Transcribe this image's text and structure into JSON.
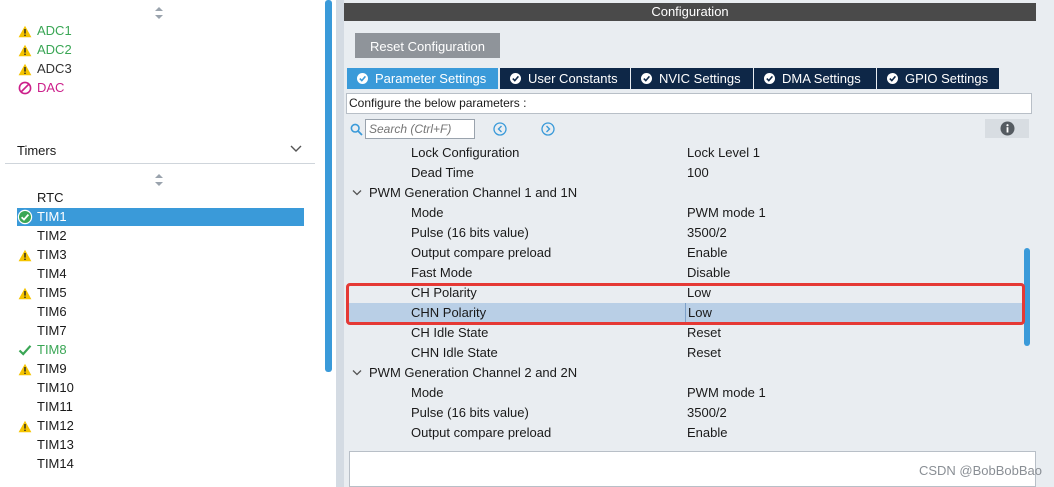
{
  "left": {
    "analog_items": [
      {
        "label": "ADC1",
        "icon": "warning-icon",
        "color": "#3aa655"
      },
      {
        "label": "ADC2",
        "icon": "warning-icon",
        "color": "#3aa655"
      },
      {
        "label": "ADC3",
        "icon": "warning-icon",
        "color": "#333333"
      },
      {
        "label": "DAC",
        "icon": "disabled-icon",
        "color": "#cc1f8a"
      }
    ],
    "section_title": "Timers",
    "timer_items": [
      {
        "label": "RTC",
        "icon": "none"
      },
      {
        "label": "TIM1",
        "icon": "check-circle-icon",
        "selected": true
      },
      {
        "label": "TIM2",
        "icon": "none"
      },
      {
        "label": "TIM3",
        "icon": "warning-icon"
      },
      {
        "label": "TIM4",
        "icon": "none"
      },
      {
        "label": "TIM5",
        "icon": "warning-icon"
      },
      {
        "label": "TIM6",
        "icon": "none"
      },
      {
        "label": "TIM7",
        "icon": "none"
      },
      {
        "label": "TIM8",
        "icon": "check-icon",
        "color": "#3aa655"
      },
      {
        "label": "TIM9",
        "icon": "warning-icon"
      },
      {
        "label": "TIM10",
        "icon": "none"
      },
      {
        "label": "TIM11",
        "icon": "none"
      },
      {
        "label": "TIM12",
        "icon": "warning-icon"
      },
      {
        "label": "TIM13",
        "icon": "none"
      },
      {
        "label": "TIM14",
        "icon": "none"
      }
    ]
  },
  "config": {
    "title": "Configuration",
    "reset_label": "Reset Configuration",
    "tabs": [
      {
        "label": "Parameter Settings",
        "active": true
      },
      {
        "label": "User Constants"
      },
      {
        "label": "NVIC Settings"
      },
      {
        "label": "DMA Settings"
      },
      {
        "label": "GPIO Settings"
      }
    ],
    "configure_text": "Configure the below parameters :",
    "search_placeholder": "Search (Ctrl+F)",
    "params": [
      {
        "name": "Lock Configuration",
        "value": "Lock Level 1"
      },
      {
        "name": "Dead Time",
        "value": "100"
      },
      {
        "name": "PWM Generation Channel 1 and 1N",
        "group": true
      },
      {
        "name": "Mode",
        "value": "PWM mode 1"
      },
      {
        "name": "Pulse (16 bits value)",
        "value": "3500/2"
      },
      {
        "name": "Output compare preload",
        "value": "Enable"
      },
      {
        "name": "Fast Mode",
        "value": "Disable"
      },
      {
        "name": "CH Polarity",
        "value": "Low"
      },
      {
        "name": "CHN Polarity",
        "value": "Low",
        "selected": true
      },
      {
        "name": "CH Idle State",
        "value": "Reset"
      },
      {
        "name": "CHN Idle State",
        "value": "Reset"
      },
      {
        "name": "PWM Generation Channel 2 and 2N",
        "group": true
      },
      {
        "name": "Mode",
        "value": "PWM mode 1"
      },
      {
        "name": "Pulse (16 bits value)",
        "value": "3500/2"
      },
      {
        "name": "Output compare preload",
        "value": "Enable"
      }
    ]
  },
  "watermark": "CSDN @BobBobBao",
  "colors": {
    "accent": "#3a9ad9",
    "tab_dark": "#0e2747",
    "highlight": "#e53935",
    "warning": "#f5c400"
  }
}
